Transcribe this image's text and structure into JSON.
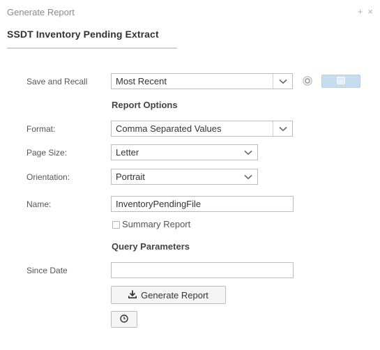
{
  "dialog": {
    "title": "Generate Report",
    "pin_glyph": "+",
    "close_glyph": "×"
  },
  "report": {
    "title": "SSDT Inventory Pending Extract"
  },
  "save_recall": {
    "label": "Save and Recall",
    "value": "Most Recent",
    "reset_icon": "reset-icon",
    "save_icon": "save-icon"
  },
  "report_options": {
    "heading": "Report Options",
    "format": {
      "label": "Format:",
      "value": "Comma Separated Values"
    },
    "page_size": {
      "label": "Page Size:",
      "value": "Letter"
    },
    "orientation": {
      "label": "Orientation:",
      "value": "Portrait"
    },
    "name": {
      "label": "Name:",
      "value": "InventoryPendingFile"
    },
    "summary": {
      "label": "Summary Report",
      "checked": false
    }
  },
  "query_parameters": {
    "heading": "Query Parameters",
    "since_date": {
      "label": "Since Date",
      "value": ""
    }
  },
  "actions": {
    "generate_label": "Generate Report",
    "generate_icon": "download-icon",
    "history_icon": "clock-icon"
  },
  "colors": {
    "save_button": "#c6dcef",
    "border": "#bcbcbc",
    "title_underline": "#d4d4d4"
  }
}
